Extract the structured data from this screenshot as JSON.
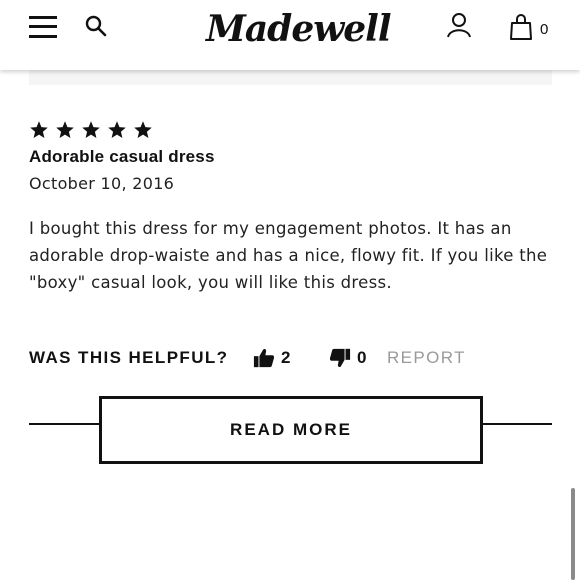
{
  "header": {
    "logo_text": "Madewell",
    "bag_count": "0",
    "icons": [
      "menu-icon",
      "search-icon",
      "account-icon",
      "bag-icon"
    ]
  },
  "review": {
    "rating": 5,
    "title": "Adorable casual dress",
    "date": "October 10, 2016",
    "body": "I bought this dress for my engagement photos. It has an adorable drop-waiste and has a nice, flowy fit. If you like the \"boxy\" casual look, you will like this dress.",
    "helpful_label": "WAS THIS HELPFUL?",
    "helpful_yes_count": "2",
    "helpful_no_count": "0",
    "report_label": "REPORT"
  },
  "actions": {
    "read_more_label": "READ MORE"
  },
  "colors": {
    "text": "#111111",
    "muted": "#9a9a9a",
    "strip": "#f5f5f5",
    "background": "#ffffff"
  }
}
